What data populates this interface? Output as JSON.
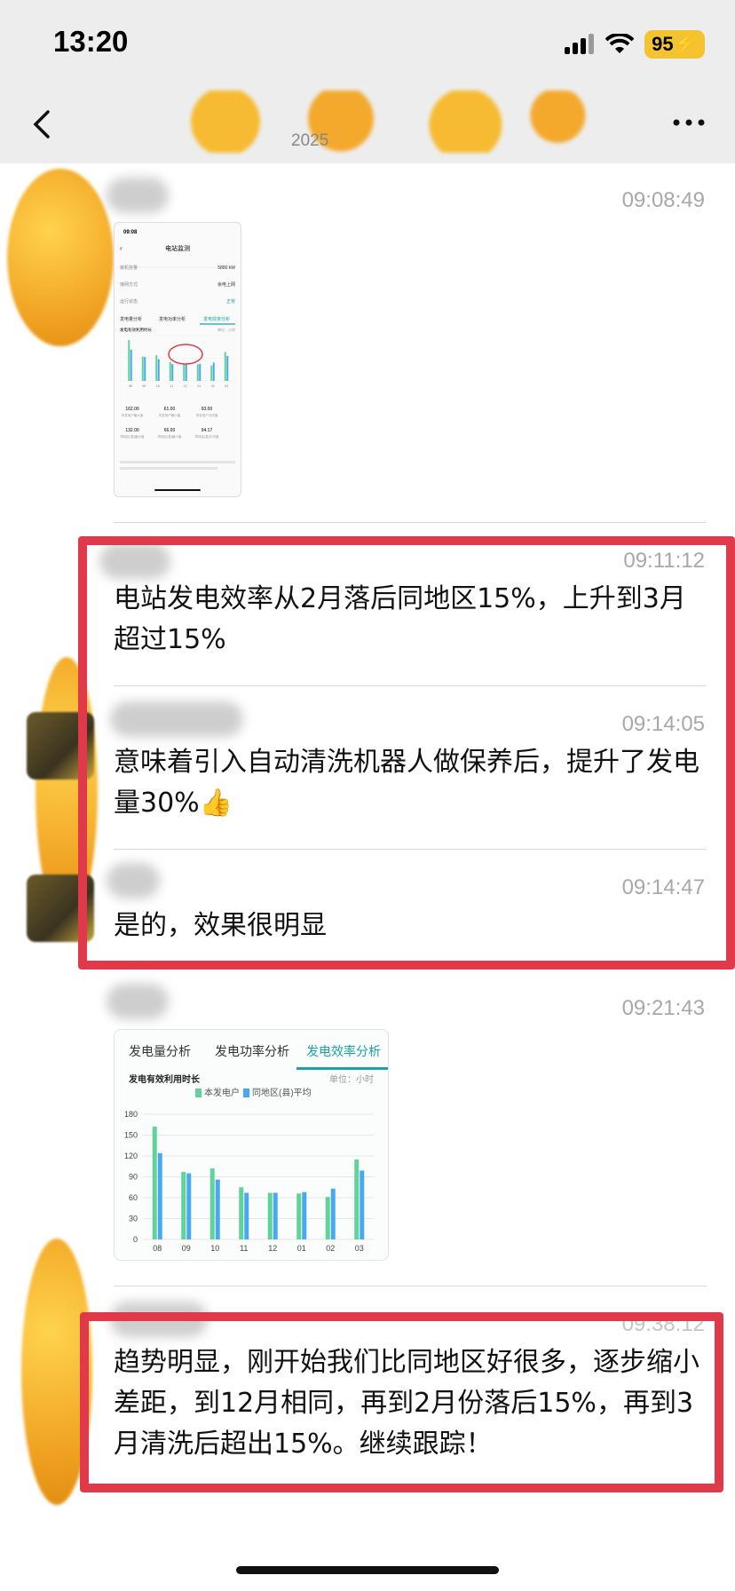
{
  "status_bar": {
    "time": "13:20",
    "battery": "95"
  },
  "nav": {
    "date_subtitle": "2025"
  },
  "messages": [
    {
      "time": "09:08:49",
      "type": "image"
    },
    {
      "time": "09:11:12",
      "text": "电站发电效率从2月落后同地区15%，上升到3月超过15%"
    },
    {
      "time": "09:14:05",
      "text": "意味着引入自动清洗机器人做保养后，提升了发电量30%👍"
    },
    {
      "time": "09:14:47",
      "text": "是的，效果很明显"
    },
    {
      "time": "09:21:43",
      "type": "image"
    },
    {
      "time": "09:38:12",
      "text": "趋势明显，刚开始我们比同地区好很多，逐步缩小差距，到12月相同，再到2月份落后15%，再到3月清洗后超出15%。继续跟踪！"
    }
  ],
  "thumb1": {
    "time": "09:08",
    "title": "电站监测",
    "rows": [
      {
        "label": "装机容量",
        "value": "5880 kW"
      },
      {
        "label": "接网方式",
        "value": "余电上网"
      },
      {
        "label": "运行状态",
        "value": "正常"
      }
    ],
    "tabs": [
      "发电量分析",
      "发电功率分析",
      "发电效率分析"
    ],
    "chart_title": "发电有效利用时长",
    "unit": "单位：小时",
    "stats": [
      {
        "value": "162.00",
        "label": "本发电户最大值"
      },
      {
        "value": "61.00",
        "label": "本发电户最小值"
      },
      {
        "value": "93.00",
        "label": "本发电户平均值"
      },
      {
        "value": "132.00",
        "label": "同地区(县)最大值"
      },
      {
        "value": "66.00",
        "label": "同地区(县)最小值"
      },
      {
        "value": "94.17",
        "label": "同地区(县)平均值"
      }
    ]
  },
  "chart": {
    "tabs": [
      "发电量分析",
      "发电功率分析",
      "发电效率分析"
    ],
    "active_tab": "发电效率分析",
    "title": "发电有效利用时长",
    "unit": "单位：小时",
    "legend": [
      "本发电户",
      "同地区(县)平均"
    ],
    "colors": {
      "own": "#5fd39a",
      "region": "#4aa8f0",
      "accent": "#1aa3a3"
    }
  },
  "chart_data": {
    "type": "bar",
    "title": "发电有效利用时长",
    "ylabel": "单位：小时",
    "categories": [
      "08",
      "09",
      "10",
      "11",
      "12",
      "01",
      "02",
      "03"
    ],
    "series": [
      {
        "name": "本发电户",
        "values": [
          162,
          97,
          102,
          75,
          67,
          66,
          61,
          115
        ]
      },
      {
        "name": "同地区(县)平均",
        "values": [
          124,
          95,
          86,
          67,
          67,
          68,
          73,
          99
        ]
      }
    ],
    "yticks": [
      0,
      30,
      60,
      90,
      120,
      150,
      180
    ],
    "ylim": [
      0,
      180
    ],
    "legend_position": "top-center"
  }
}
